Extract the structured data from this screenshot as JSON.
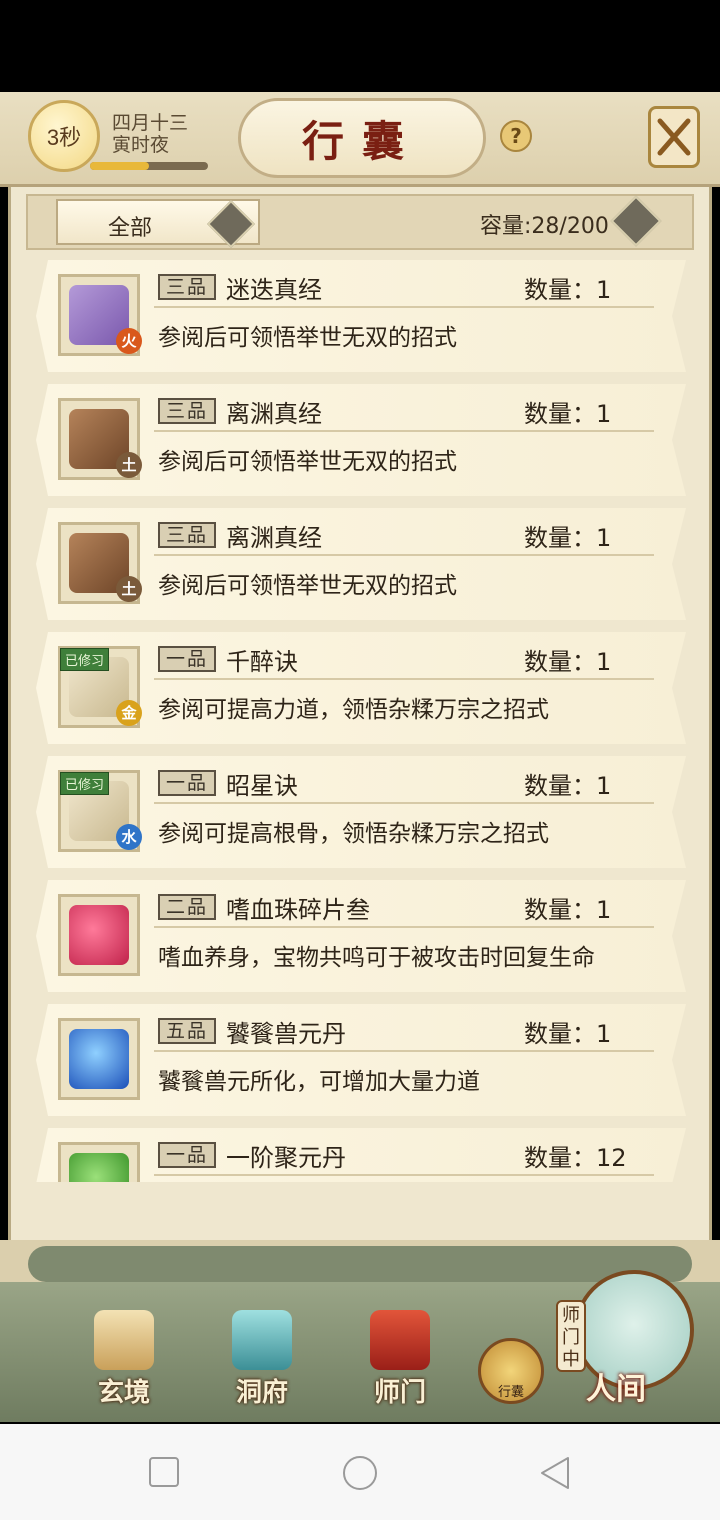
{
  "header": {
    "timer": "3秒",
    "date_line1": "四月十三",
    "date_line2": "寅时夜",
    "title": "行囊",
    "help_label": "?"
  },
  "filter": {
    "selected": "全部",
    "capacity": "容量:28/200"
  },
  "items": [
    {
      "grade": "三品",
      "name": "迷迭真经",
      "qty": "数量：1",
      "desc": "参阅后可领悟举世无双的招式",
      "icon": "purple-book-icon",
      "element": "火",
      "element_color": "#d9581c",
      "learned": ""
    },
    {
      "grade": "三品",
      "name": "离渊真经",
      "qty": "数量：1",
      "desc": "参阅后可领悟举世无双的招式",
      "icon": "brown-book-icon",
      "element": "土",
      "element_color": "#7a5a3a",
      "learned": ""
    },
    {
      "grade": "三品",
      "name": "离渊真经",
      "qty": "数量：1",
      "desc": "参阅后可领悟举世无双的招式",
      "icon": "brown-book-icon",
      "element": "土",
      "element_color": "#7a5a3a",
      "learned": ""
    },
    {
      "grade": "一品",
      "name": "千醉诀",
      "qty": "数量：1",
      "desc": "参阅可提高力道，领悟杂糅万宗之招式",
      "icon": "scroll-icon",
      "element": "金",
      "element_color": "#d9a21c",
      "learned": "已修习"
    },
    {
      "grade": "一品",
      "name": "昭星诀",
      "qty": "数量：1",
      "desc": "参阅可提高根骨，领悟杂糅万宗之招式",
      "icon": "scroll-icon",
      "element": "水",
      "element_color": "#2f74c8",
      "learned": "已修习"
    },
    {
      "grade": "二品",
      "name": "嗜血珠碎片叁",
      "qty": "数量：1",
      "desc": "嗜血养身，宝物共鸣可于被攻击时回复生命",
      "icon": "red-shard-icon",
      "element": "",
      "element_color": "",
      "learned": ""
    },
    {
      "grade": "五品",
      "name": "饕餮兽元丹",
      "qty": "数量：1",
      "desc": "饕餮兽元所化，可增加大量力道",
      "icon": "blue-orb-icon",
      "element": "",
      "element_color": "",
      "learned": ""
    },
    {
      "grade": "一品",
      "name": "一阶聚元丹",
      "qty": "数量：12",
      "desc": "",
      "icon": "green-pill-icon",
      "element": "",
      "element_color": "",
      "learned": ""
    }
  ],
  "nav": {
    "items": [
      {
        "label": "玄境",
        "icon": "scroll-map-icon"
      },
      {
        "label": "洞府",
        "icon": "lantern-icon"
      },
      {
        "label": "师门",
        "icon": "banner-icon"
      }
    ],
    "bag_label": "行囊",
    "shimen_status": "师门中",
    "renjian_label": "人间"
  },
  "colors": {
    "title_red": "#7a1f12",
    "panel_bg": "#efe7cf",
    "item_bg": "#fcf6e2"
  }
}
